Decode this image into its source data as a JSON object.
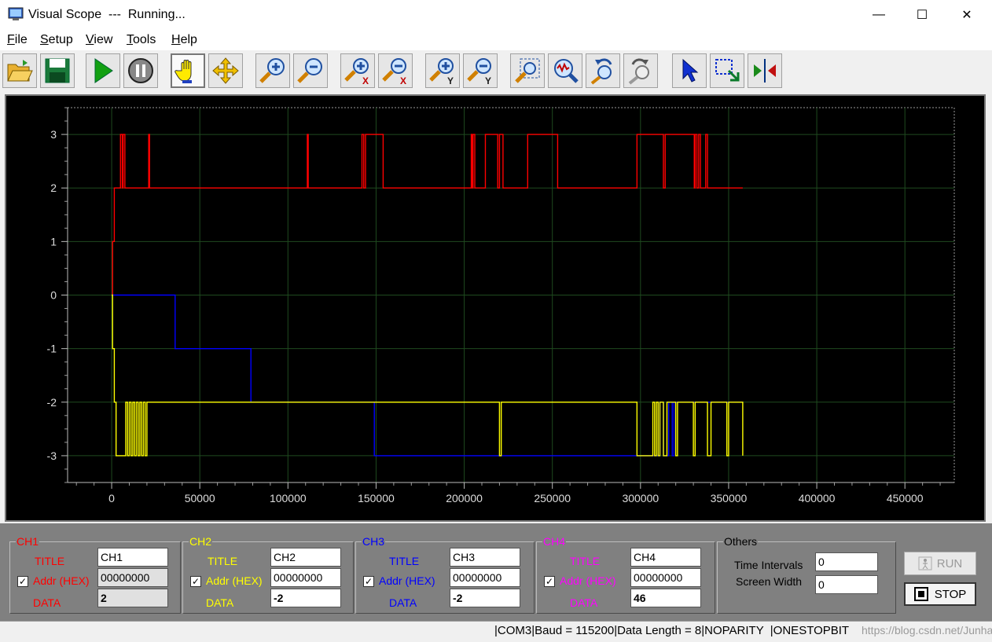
{
  "window": {
    "title": "Visual Scope  ---  Running...",
    "minimize": "—",
    "maximize": "☐",
    "close": "✕"
  },
  "menu": [
    {
      "first": "F",
      "rest": "ile"
    },
    {
      "first": "S",
      "rest": "etup"
    },
    {
      "first": "V",
      "rest": "iew"
    },
    {
      "first": "T",
      "rest": "ools"
    },
    {
      "first": "H",
      "rest": "elp"
    }
  ],
  "toolbar": [
    "open-icon",
    "save-icon",
    "run-icon",
    "pause-icon",
    "hand-pan-icon",
    "move-icon",
    "zoom-in-icon",
    "zoom-out-icon",
    "zoom-in-x-icon",
    "zoom-out-x-icon",
    "zoom-in-y-icon",
    "zoom-out-y-icon",
    "zoom-fit-icon",
    "zoom-wave-icon",
    "zoom-undo-icon",
    "zoom-redo-icon",
    "pointer-icon",
    "select-area-icon",
    "cursor-measure-icon"
  ],
  "chart_data": {
    "type": "line",
    "ylim": [
      -3.5,
      3.5
    ],
    "xlim": [
      -25000,
      478000
    ],
    "yticks": [
      "3",
      "2",
      "1",
      "0",
      "-1",
      "-2",
      "-3"
    ],
    "xticks": [
      "0",
      "50000",
      "100000",
      "150000",
      "200000",
      "250000",
      "300000",
      "350000",
      "400000",
      "450000"
    ],
    "grid": true,
    "background": "#000000",
    "series": [
      {
        "color": "#ff0000",
        "step": true,
        "x": [
          0,
          500,
          1500,
          3000,
          5000,
          6000,
          6500,
          7000,
          7500,
          21000,
          21500,
          111000,
          111500,
          142000,
          143000,
          144000,
          145000,
          153000,
          154000,
          204000,
          204500,
          205000,
          206000,
          208000,
          212000,
          219000,
          220000,
          222000,
          223000,
          236000,
          237000,
          252000,
          253000,
          298000,
          299000,
          313000,
          314000,
          330000,
          330500,
          331000,
          332000,
          333000,
          334000,
          337000,
          338000,
          358000
        ],
        "y": [
          0,
          1,
          2,
          2,
          3,
          2,
          3,
          3,
          2,
          3,
          2,
          3,
          2,
          3,
          2,
          3,
          3,
          3,
          2,
          3,
          2,
          3,
          2,
          2,
          3,
          2,
          3,
          2,
          2,
          3,
          3,
          3,
          2,
          3,
          3,
          2,
          3,
          3,
          2,
          3,
          2,
          3,
          2,
          3,
          2,
          2
        ]
      },
      {
        "color": "#0000ff",
        "step": true,
        "x": [
          0,
          500,
          36000,
          79000,
          80000,
          148000,
          149000,
          310000,
          311000,
          313000,
          316000,
          318000,
          319000,
          358000
        ],
        "y": [
          0,
          0,
          -1,
          -2,
          -2,
          -2,
          -3,
          -3,
          -2,
          -3,
          -2,
          -3,
          -2,
          -2
        ]
      },
      {
        "color": "#ffff00",
        "step": true,
        "x": [
          0,
          500,
          1500,
          2500,
          8000,
          9000,
          10000,
          11000,
          12000,
          13000,
          14000,
          15000,
          16000,
          17000,
          18000,
          19000,
          20000,
          22000,
          220000,
          221000,
          298000,
          307000,
          308000,
          309000,
          310000,
          311000,
          313000,
          315000,
          318000,
          320000,
          321000,
          330000,
          331000,
          338000,
          340000,
          349000,
          350000,
          358000
        ],
        "y": [
          0,
          -1,
          -2,
          -3,
          -2,
          -3,
          -2,
          -3,
          -2,
          -3,
          -2,
          -3,
          -2,
          -3,
          -2,
          -3,
          -2,
          -2,
          -3,
          -2,
          -3,
          -2,
          -3,
          -2,
          -3,
          -2,
          -3,
          -2,
          -2,
          -3,
          -2,
          -3,
          -2,
          -3,
          -2,
          -3,
          -2,
          -3
        ]
      }
    ]
  },
  "channels": [
    {
      "name": "CH1",
      "color": "#ff0000",
      "title_label": "TITLE",
      "title_value": "CH1",
      "addr_label": "Addr (HEX)",
      "addr_value": "00000000",
      "data_label": "DATA",
      "data_value": "2",
      "checked": "✓"
    },
    {
      "name": "CH2",
      "color": "#ffff00",
      "title_label": "TITLE",
      "title_value": "CH2",
      "addr_label": "Addr (HEX)",
      "addr_value": "00000000",
      "data_label": "DATA",
      "data_value": "-2",
      "checked": "✓"
    },
    {
      "name": "CH3",
      "color": "#0000ff",
      "title_label": "TITLE",
      "title_value": "CH3",
      "addr_label": "Addr (HEX)",
      "addr_value": "00000000",
      "data_label": "DATA",
      "data_value": "-2",
      "checked": "✓"
    },
    {
      "name": "CH4",
      "color": "#ff00ff",
      "title_label": "TITLE",
      "title_value": "CH4",
      "addr_label": "Addr (HEX)",
      "addr_value": "00000000",
      "data_label": "DATA",
      "data_value": "46",
      "checked": "✓"
    }
  ],
  "others": {
    "name": "Others",
    "time_label": "Time Intervals",
    "time_value": "0",
    "width_label": "Screen Width",
    "width_value": "0"
  },
  "buttons": {
    "run": "RUN",
    "stop": "STOP"
  },
  "status": {
    "text": "|COM3|Baud = 115200|Data Length = 8|NOPARITY  |ONESTOPBIT",
    "watermark": "https://blog.csdn.net/Junhanis"
  }
}
